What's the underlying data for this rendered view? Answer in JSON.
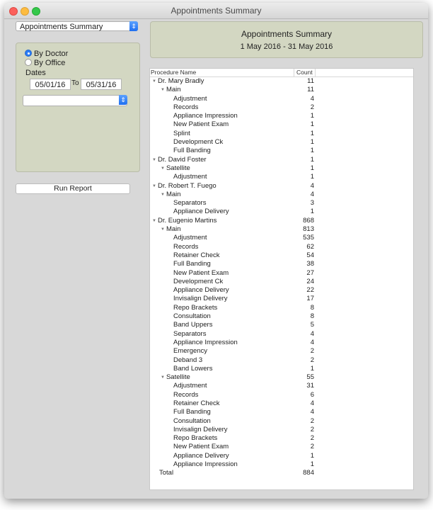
{
  "window": {
    "title": "Appointments Summary"
  },
  "report_selector": {
    "value": "Appointments Summary"
  },
  "options": {
    "by_doctor": "By Doctor",
    "by_office": "By Office",
    "dates_label": "Dates",
    "from_date": "05/01/16",
    "to_label": "To",
    "to_date": "05/31/16",
    "selected_grouping": "By Doctor"
  },
  "run_button": "Run Report",
  "header": {
    "title": "Appointments Summary",
    "subtitle": "1 May 2016 - 31 May 2016"
  },
  "table": {
    "columns": [
      "Procedure Name",
      "Count"
    ],
    "rows": [
      {
        "level": 0,
        "label": "Dr. Mary Bradly",
        "count": "11",
        "expand": true
      },
      {
        "level": 1,
        "label": "Main",
        "count": "11",
        "expand": true
      },
      {
        "level": 2,
        "label": "Adjustment",
        "count": "4"
      },
      {
        "level": 2,
        "label": "Records",
        "count": "2"
      },
      {
        "level": 2,
        "label": "Appliance Impression",
        "count": "1"
      },
      {
        "level": 2,
        "label": "New Patient Exam",
        "count": "1"
      },
      {
        "level": 2,
        "label": "Splint",
        "count": "1"
      },
      {
        "level": 2,
        "label": "Development Ck",
        "count": "1"
      },
      {
        "level": 2,
        "label": "Full Banding",
        "count": "1"
      },
      {
        "level": 0,
        "label": "Dr. David Foster",
        "count": "1",
        "expand": true
      },
      {
        "level": 1,
        "label": "Satellite",
        "count": "1",
        "expand": true
      },
      {
        "level": 2,
        "label": "Adjustment",
        "count": "1"
      },
      {
        "level": 0,
        "label": "Dr. Robert T. Fuego",
        "count": "4",
        "expand": true
      },
      {
        "level": 1,
        "label": "Main",
        "count": "4",
        "expand": true
      },
      {
        "level": 2,
        "label": "Separators",
        "count": "3"
      },
      {
        "level": 2,
        "label": "Appliance Delivery",
        "count": "1"
      },
      {
        "level": 0,
        "label": "Dr. Eugenio Martins",
        "count": "868",
        "expand": true
      },
      {
        "level": 1,
        "label": "Main",
        "count": "813",
        "expand": true
      },
      {
        "level": 2,
        "label": "Adjustment",
        "count": "535"
      },
      {
        "level": 2,
        "label": "Records",
        "count": "62"
      },
      {
        "level": 2,
        "label": "Retainer Check",
        "count": "54"
      },
      {
        "level": 2,
        "label": "Full Banding",
        "count": "38"
      },
      {
        "level": 2,
        "label": "New Patient Exam",
        "count": "27"
      },
      {
        "level": 2,
        "label": "Development Ck",
        "count": "24"
      },
      {
        "level": 2,
        "label": "Appliance Delivery",
        "count": "22"
      },
      {
        "level": 2,
        "label": "Invisalign Delivery",
        "count": "17"
      },
      {
        "level": 2,
        "label": "Repo Brackets",
        "count": "8"
      },
      {
        "level": 2,
        "label": "Consultation",
        "count": "8"
      },
      {
        "level": 2,
        "label": "Band Uppers",
        "count": "5"
      },
      {
        "level": 2,
        "label": "Separators",
        "count": "4"
      },
      {
        "level": 2,
        "label": "Appliance Impression",
        "count": "4"
      },
      {
        "level": 2,
        "label": "Emergency",
        "count": "2"
      },
      {
        "level": 2,
        "label": "Deband 3",
        "count": "2"
      },
      {
        "level": 2,
        "label": "Band Lowers",
        "count": "1"
      },
      {
        "level": 1,
        "label": "Satellite",
        "count": "55",
        "expand": true
      },
      {
        "level": 2,
        "label": "Adjustment",
        "count": "31"
      },
      {
        "level": 2,
        "label": "Records",
        "count": "6"
      },
      {
        "level": 2,
        "label": "Retainer Check",
        "count": "4"
      },
      {
        "level": 2,
        "label": "Full Banding",
        "count": "4"
      },
      {
        "level": 2,
        "label": "Consultation",
        "count": "2"
      },
      {
        "level": 2,
        "label": "Invisalign Delivery",
        "count": "2"
      },
      {
        "level": 2,
        "label": "Repo Brackets",
        "count": "2"
      },
      {
        "level": 2,
        "label": "New Patient Exam",
        "count": "2"
      },
      {
        "level": 2,
        "label": "Appliance Delivery",
        "count": "1"
      },
      {
        "level": 2,
        "label": "Appliance Impression",
        "count": "1"
      },
      {
        "level": 0,
        "label": "Total",
        "count": "884",
        "total": true
      }
    ]
  }
}
